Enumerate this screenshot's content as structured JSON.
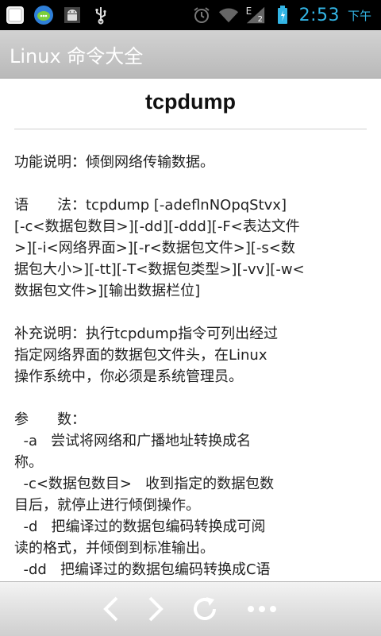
{
  "status_bar": {
    "time": "2:53",
    "ampm": "下午",
    "signal_label": "E",
    "sim_label": "2",
    "icons": [
      "app-icon",
      "chat-icon",
      "android-icon",
      "usb-icon",
      "alarm-icon",
      "wifi-icon",
      "signal-icon",
      "battery-icon"
    ]
  },
  "header": {
    "title": "Linux 命令大全"
  },
  "article": {
    "title": "tcpdump",
    "lines": [
      "功能说明：倾倒网络传输数据。",
      "",
      "语　　法：tcpdump [-adeflnNOpqStvx]",
      "[-c<数据包数目>][-dd][-ddd][-F<表达文件",
      ">][-i<网络界面>][-r<数据包文件>][-s<数",
      "据包大小>][-tt][-T<数据包类型>][-vv][-w<",
      "数据包文件>][输出数据栏位]",
      "",
      "补充说明：执行tcpdump指令可列出经过",
      "指定网络界面的数据包文件头，在Linux",
      "操作系统中，你必须是系统管理员。",
      "",
      "参　　数：",
      "  -a   尝试将网络和广播地址转换成名",
      "称。",
      "  -c<数据包数目>   收到指定的数据包数",
      "目后，就停止进行倾倒操作。",
      "  -d   把编译过的数据包编码转换成可阅",
      "读的格式，并倾倒到标准输出。",
      "  -dd   把编译过的数据包编码转换成C语"
    ]
  },
  "bottom_nav": {
    "icons": [
      "back-icon",
      "forward-icon",
      "refresh-icon",
      "more-icon"
    ],
    "color": "#ffffff"
  }
}
